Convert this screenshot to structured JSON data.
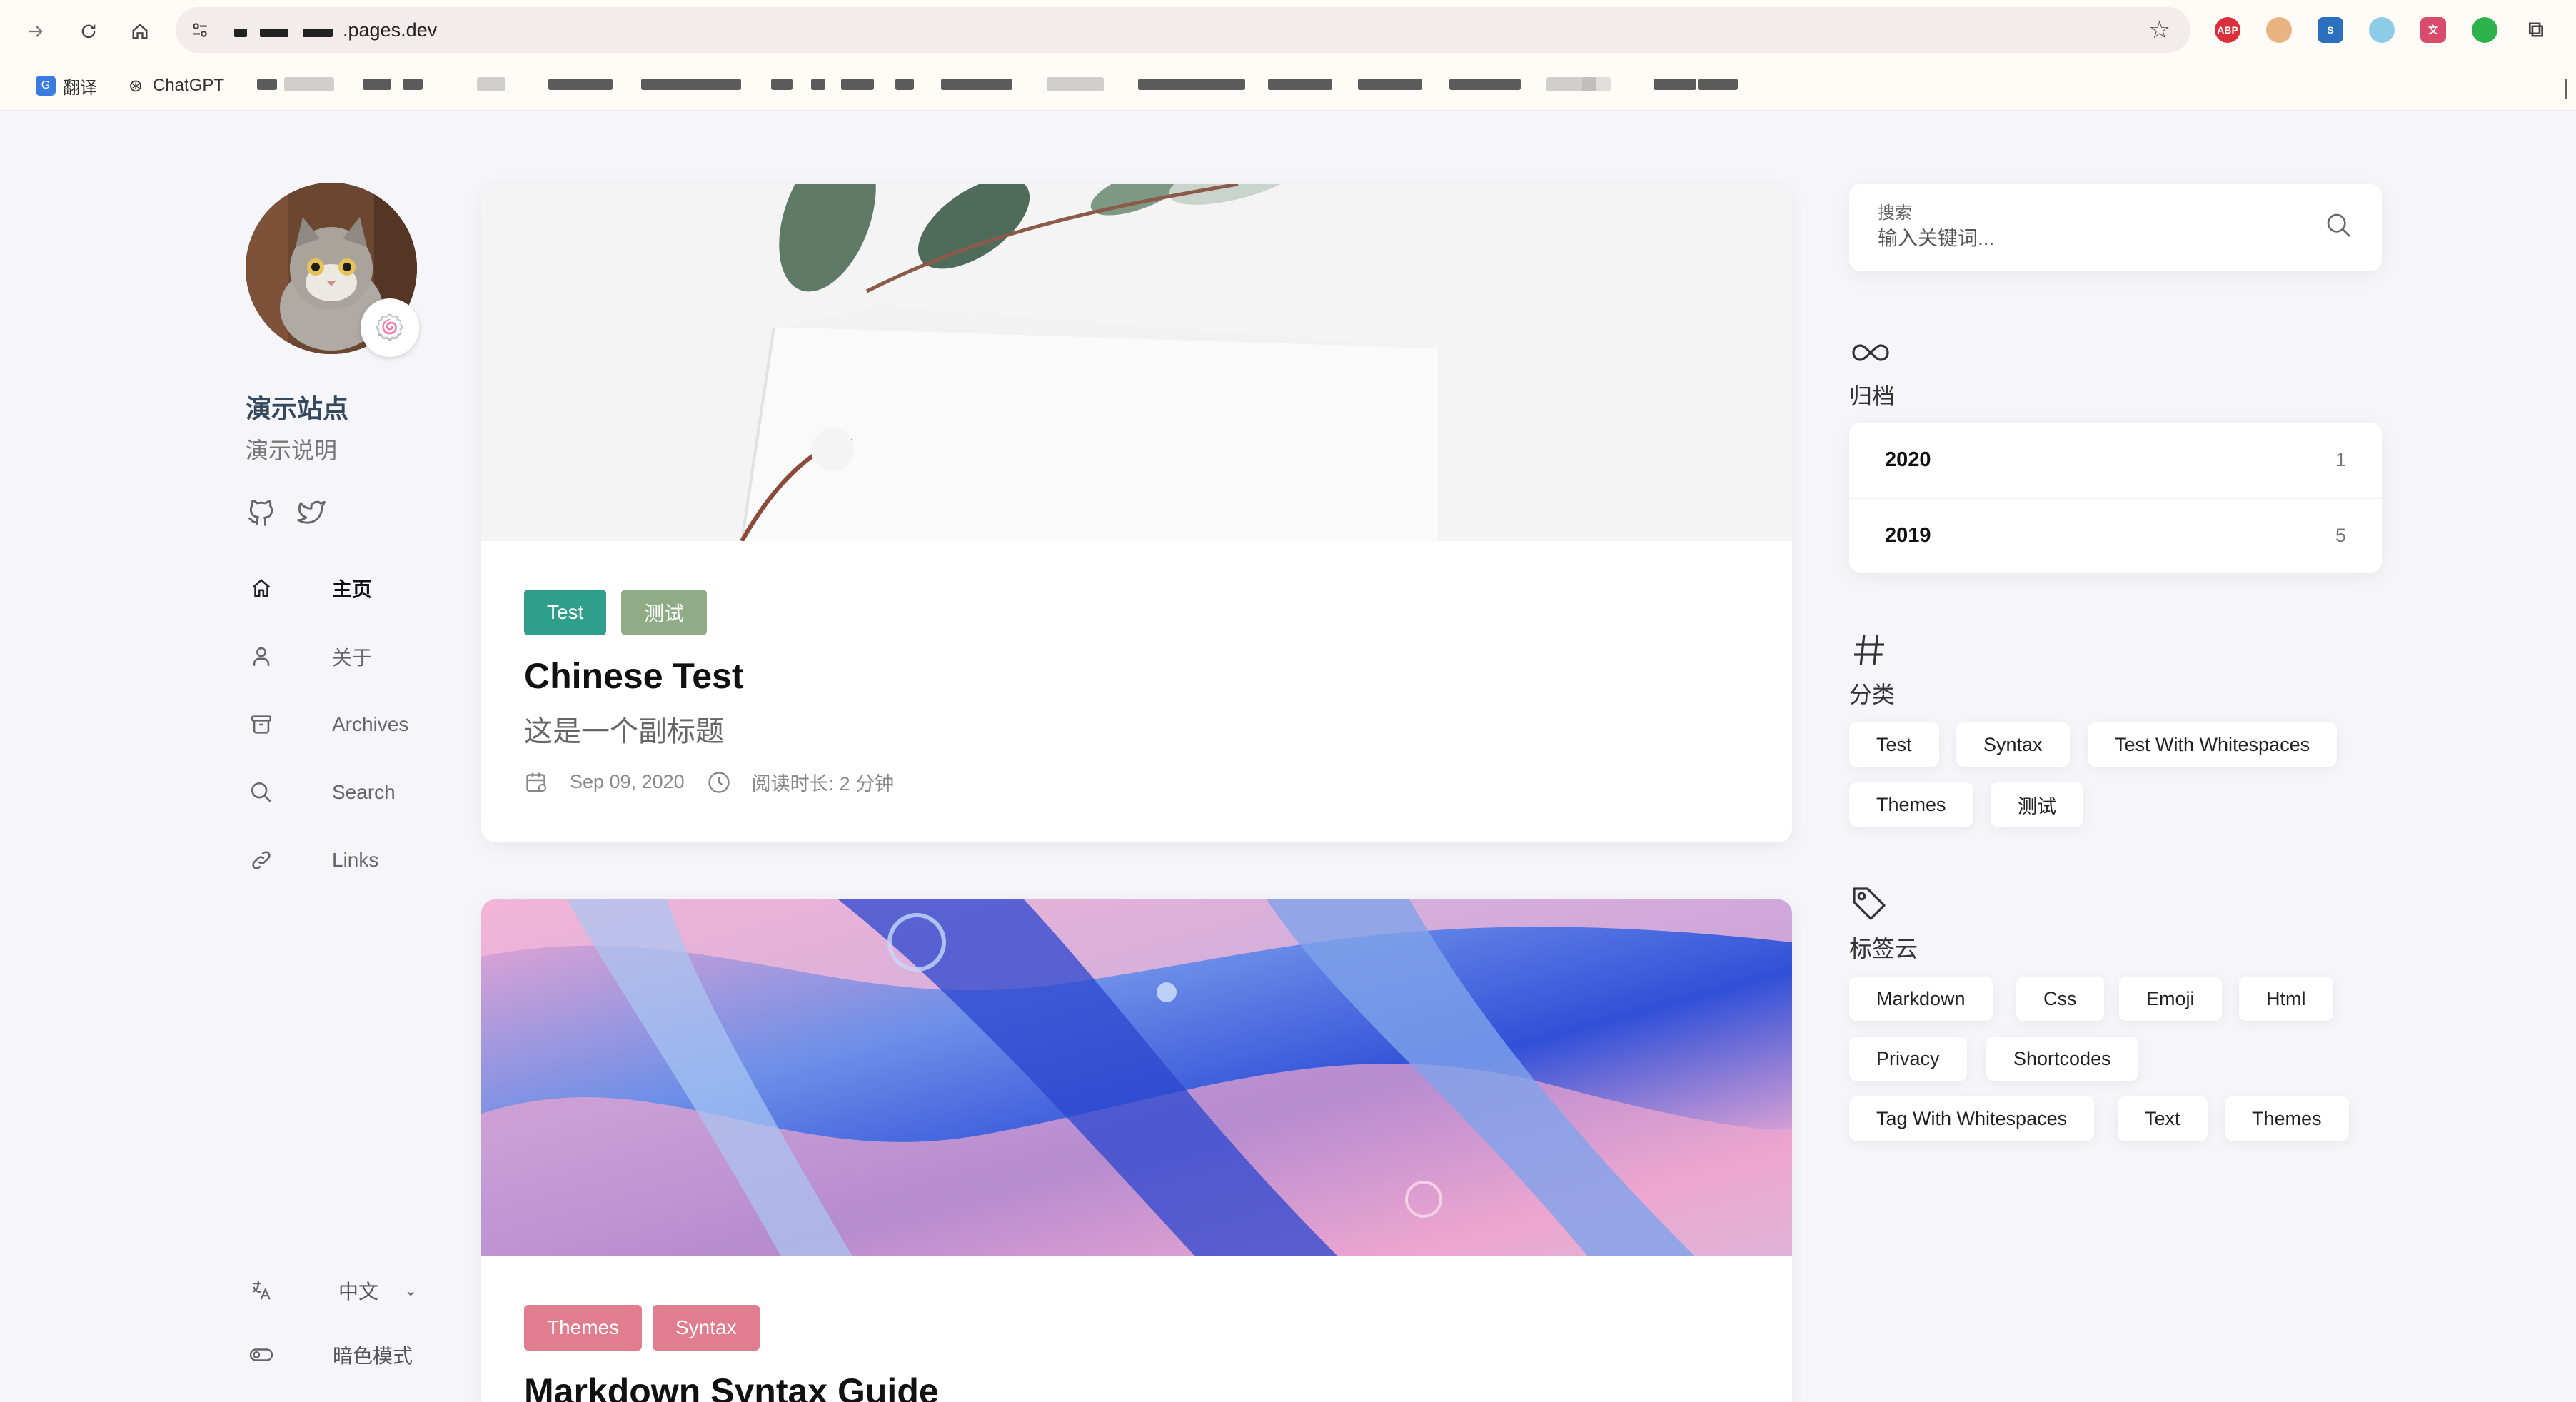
{
  "browser": {
    "url": ".pages.dev",
    "bookmarks": [
      {
        "label": "翻译",
        "icon": "translate-icon"
      },
      {
        "label": "ChatGPT",
        "icon": "chatgpt-icon"
      }
    ]
  },
  "sidebar": {
    "title": "演示站点",
    "description": "演示说明",
    "avatar_badge": "🍥",
    "menu": [
      {
        "label": "主页",
        "icon": "home-icon"
      },
      {
        "label": "关于",
        "icon": "user-icon"
      },
      {
        "label": "Archives",
        "icon": "archive-icon"
      },
      {
        "label": "Search",
        "icon": "search-icon"
      },
      {
        "label": "Links",
        "icon": "link-icon"
      }
    ],
    "language": "中文",
    "dark_mode": "暗色模式"
  },
  "posts": [
    {
      "categories": [
        "Test",
        "测试"
      ],
      "title": "Chinese Test",
      "subtitle": "这是一个副标题",
      "date": "Sep 09, 2020",
      "read_time": "阅读时长: 2 分钟"
    },
    {
      "categories": [
        "Themes",
        "Syntax"
      ],
      "title": "Markdown Syntax Guide"
    }
  ],
  "search": {
    "label": "搜索",
    "placeholder": "输入关键词..."
  },
  "archives": {
    "title": "归档",
    "years": [
      {
        "year": "2020",
        "count": "1"
      },
      {
        "year": "2019",
        "count": "5"
      }
    ]
  },
  "categories": {
    "title": "分类",
    "items": [
      "Test",
      "Syntax",
      "Test With Whitespaces",
      "Themes",
      "测试"
    ]
  },
  "tags": {
    "title": "标签云",
    "items": [
      "Markdown",
      "Css",
      "Emoji",
      "Html",
      "Privacy",
      "Shortcodes",
      "Tag With Whitespaces",
      "Text",
      "Themes"
    ]
  },
  "colors": {
    "tag_teal": "#2f9e8b",
    "tag_sage": "#8fac86",
    "tag_pink": "#e07d8e",
    "accent_dark": "#34495e"
  }
}
